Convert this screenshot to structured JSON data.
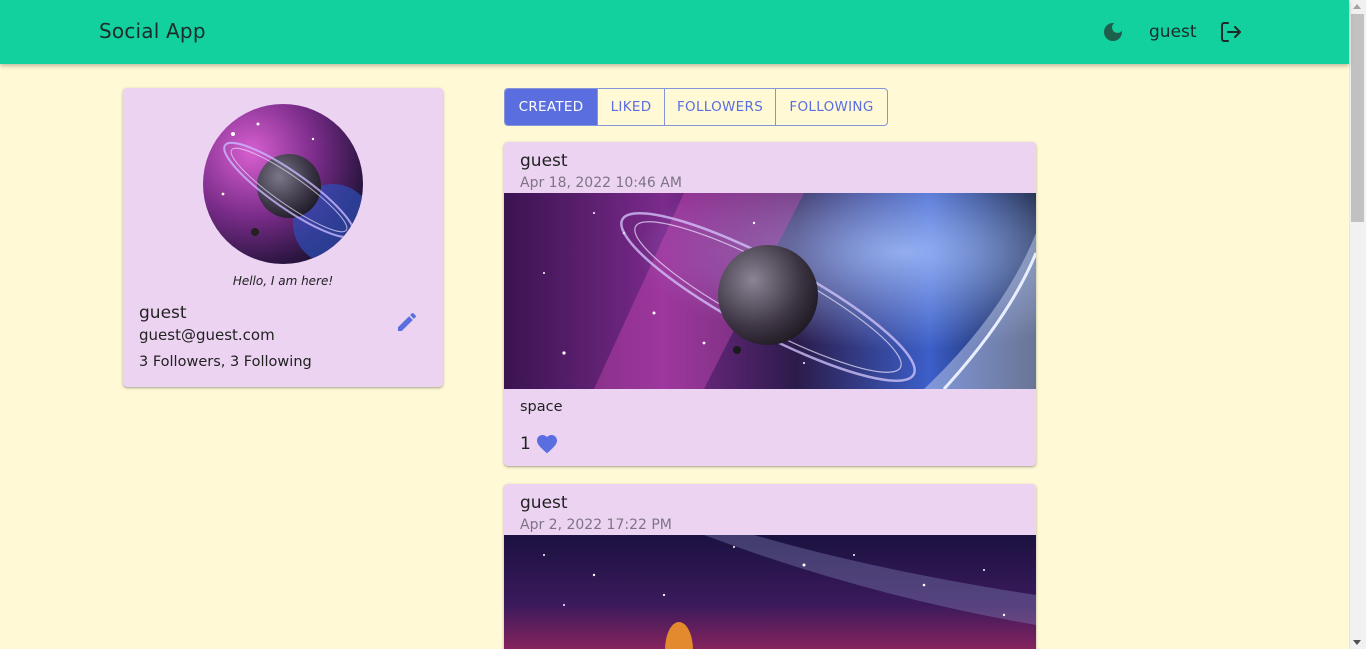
{
  "app": {
    "title": "Social App",
    "username": "guest",
    "theme_icon": "moon-icon",
    "logout_icon": "logout-icon",
    "accent_color": "#12d19f",
    "primary_color": "#5a6ee0"
  },
  "profile": {
    "bio": "Hello, I am here!",
    "name": "guest",
    "email": "guest@guest.com",
    "follow_summary": "3 Followers, 3 Following",
    "edit_icon": "pencil-icon"
  },
  "tabs": [
    {
      "label": "Created",
      "active": true
    },
    {
      "label": "Liked",
      "active": false
    },
    {
      "label": "Followers",
      "active": false
    },
    {
      "label": "Following",
      "active": false
    }
  ],
  "posts": [
    {
      "author": "guest",
      "date": "Apr 18, 2022 10:46 AM",
      "caption": "space",
      "likes": "1"
    },
    {
      "author": "guest",
      "date": "Apr 2, 2022 17:22 PM"
    }
  ]
}
